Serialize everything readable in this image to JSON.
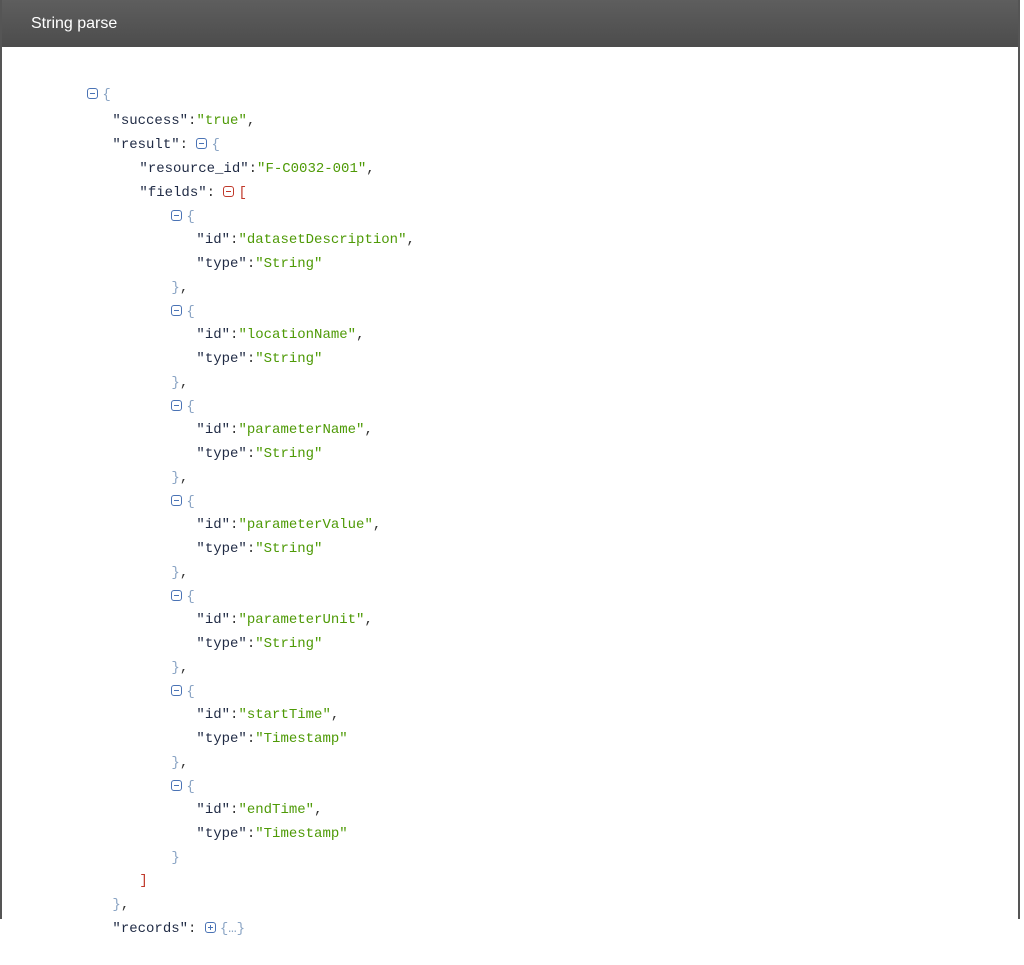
{
  "window": {
    "title": "String parse"
  },
  "json": {
    "success_key": "\"success\"",
    "success_value": "\"true\"",
    "result_key": "\"result\"",
    "resource_id_key": "\"resource_id\"",
    "resource_id_value": "\"F-C0032-001\"",
    "fields_key": "\"fields\"",
    "records_key": "\"records\"",
    "collapsed_placeholder": "…",
    "fields": [
      {
        "id_key": "\"id\"",
        "id": "\"datasetDescription\"",
        "type_key": "\"type\"",
        "type": "\"String\""
      },
      {
        "id_key": "\"id\"",
        "id": "\"locationName\"",
        "type_key": "\"type\"",
        "type": "\"String\""
      },
      {
        "id_key": "\"id\"",
        "id": "\"parameterName\"",
        "type_key": "\"type\"",
        "type": "\"String\""
      },
      {
        "id_key": "\"id\"",
        "id": "\"parameterValue\"",
        "type_key": "\"type\"",
        "type": "\"String\""
      },
      {
        "id_key": "\"id\"",
        "id": "\"parameterUnit\"",
        "type_key": "\"type\"",
        "type": "\"String\""
      },
      {
        "id_key": "\"id\"",
        "id": "\"startTime\"",
        "type_key": "\"type\"",
        "type": "\"Timestamp\""
      },
      {
        "id_key": "\"id\"",
        "id": "\"endTime\"",
        "type_key": "\"type\"",
        "type": "\"Timestamp\""
      }
    ]
  },
  "colors": {
    "title_bar": "#555555",
    "key": "#1f2a44",
    "string": "#4e9a06",
    "brace": "#8aa4c4",
    "bracket": "#c0392b",
    "toggle": "#4a73b5"
  },
  "icons": {
    "collapse": "collapse-toggle-icon",
    "expand": "expand-toggle-icon"
  }
}
